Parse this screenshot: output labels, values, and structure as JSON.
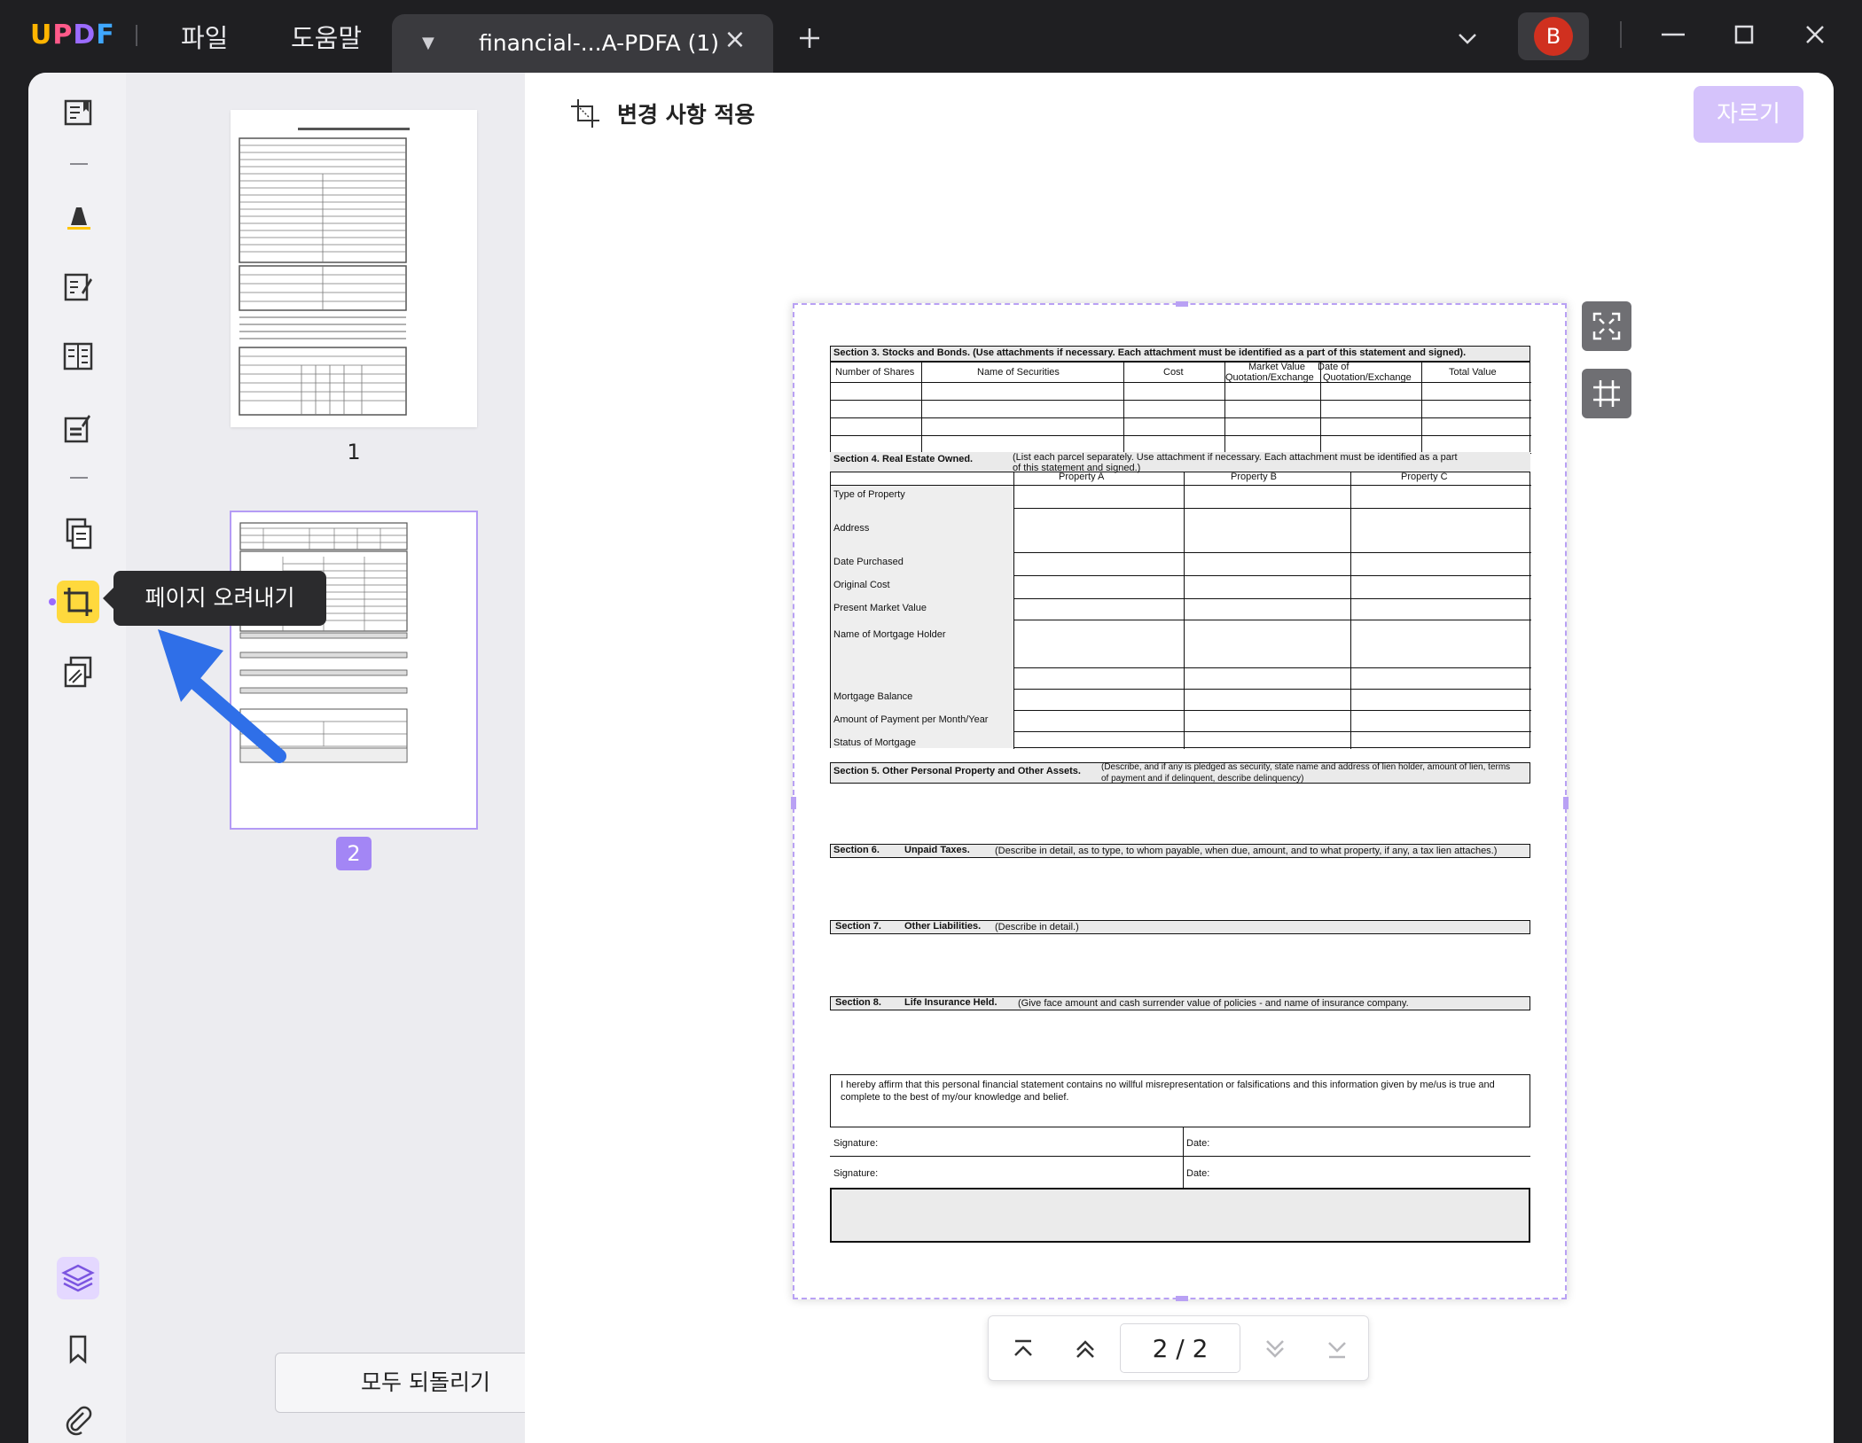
{
  "titlebar": {
    "logo": {
      "u": "U",
      "p": "P",
      "d": "D",
      "f": "F"
    },
    "menu": {
      "file": "파일",
      "help": "도움말"
    },
    "tab_title": "financial-...A-PDFA (1)",
    "avatar_letter": "B"
  },
  "thumbnails": {
    "page1_label": "1",
    "page2_label": "2",
    "reset_button": "모두 되돌리기"
  },
  "tooltip": "페이지 오려내기",
  "toolbar": {
    "apply_changes": "변경 사항 적용",
    "crop_button": "자르기"
  },
  "pager": {
    "display": "2  /  2"
  },
  "pdf": {
    "s3_title": "Section 3.  Stocks and Bonds. (Use attachments if necessary.  Each attachment must be identified as a part of this statement and signed).",
    "s3_cols": [
      "Number of Shares",
      "Name of Securities",
      "Cost",
      "Market Value",
      "Quotation/Exchange",
      "Date of",
      "Quotation/Exchange",
      "Total Value"
    ],
    "s4_title": "Section 4. Real Estate Owned.",
    "s4_note_1": "(List each parcel separately.  Use attachment if necessary.  Each attachment must be identified as a part",
    "s4_note_2": "of this statement and signed.)",
    "s4_cols": [
      "Property A",
      "Property B",
      "Property C"
    ],
    "s4_rows": [
      "Type of Property",
      "Address",
      "Date Purchased",
      "Original Cost",
      "Present Market Value",
      "Name of Mortgage Holder",
      "Mortgage Balance",
      "Amount of Payment per Month/Year",
      "Status of Mortgage"
    ],
    "s5_title": "Section 5. Other Personal Property and Other Assets.",
    "s5_note_1": "(Describe, and if any is pledged as security, state name and address of lien holder, amount of lien, terms",
    "s5_note_2": "of payment and if delinquent, describe delinquency)",
    "s6_label": "Section 6.",
    "s6_title": "Unpaid Taxes.",
    "s6_note": "(Describe in detail, as to type, to whom payable, when due, amount, and to what property, if any, a tax lien attaches.)",
    "s7_label": "Section 7.",
    "s7_title": "Other Liabilities.",
    "s7_note": "(Describe in detail.)",
    "s8_label": "Section 8.",
    "s8_title": "Life Insurance Held.",
    "s8_note": "(Give face amount and cash surrender value of policies - and name of insurance company.",
    "affirm_1": "I hereby affirm that this personal financial statement contains no willful misrepresentation or falsifications and this information given by me/us is true and",
    "affirm_2": "complete to the best of my/our knowledge and belief.",
    "signature": "Signature:",
    "date": "Date:"
  },
  "colors": {
    "accent": "#9b6bff",
    "crop_active": "#ffd93d",
    "crop_button": "#d5c3fb",
    "arrow": "#2f6fe8"
  }
}
